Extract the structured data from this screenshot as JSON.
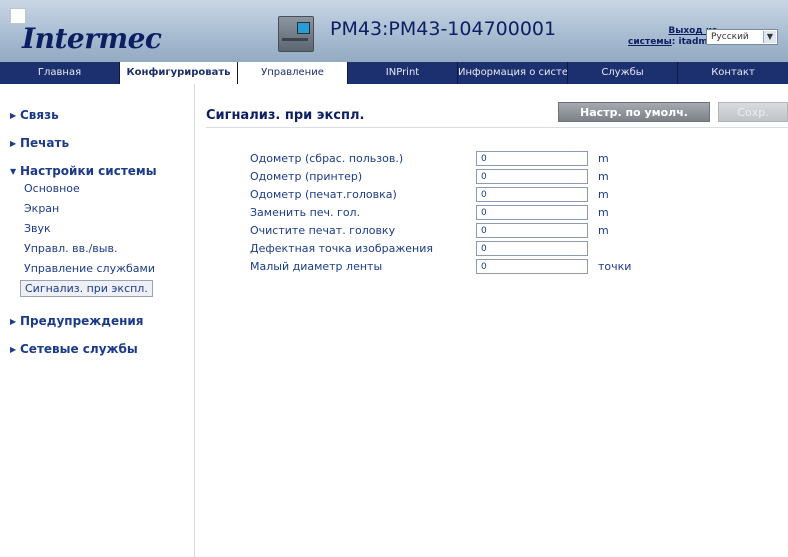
{
  "brand": {
    "logo_text": "Intermec"
  },
  "header": {
    "device_title": "PM43:PM43-104700001",
    "logout_line1": "Выход из",
    "logout_line2_link": "системы",
    "logout_line2_user": ": itadmin",
    "language": "Русский"
  },
  "nav": {
    "tabs": [
      {
        "label": "Главная"
      },
      {
        "label": "Конфигурировать"
      },
      {
        "label": "Управление"
      },
      {
        "label": "INPrint"
      },
      {
        "label": "Информация о системе"
      },
      {
        "label": "Службы"
      },
      {
        "label": "Контакт"
      }
    ]
  },
  "sidebar": {
    "sections": [
      {
        "label": "Связь"
      },
      {
        "label": "Печать"
      },
      {
        "label": "Настройки системы"
      },
      {
        "label": "Предупреждения"
      },
      {
        "label": "Сетевые службы"
      }
    ],
    "subitems": [
      {
        "label": "Основное"
      },
      {
        "label": "Экран"
      },
      {
        "label": "Звук"
      },
      {
        "label": "Управл. вв./выв."
      },
      {
        "label": "Управление службами"
      },
      {
        "label": "Сигнализ. при экспл."
      }
    ]
  },
  "main": {
    "title": "Сигнализ. при экспл.",
    "defaults_button": "Настр. по умолч.",
    "save_button": "Сохр.",
    "rows": [
      {
        "label": "Одометр (сбрас. пользов.)",
        "value": "0",
        "unit": "m"
      },
      {
        "label": "Одометр (принтер)",
        "value": "0",
        "unit": "m"
      },
      {
        "label": "Одометр (печат.головка)",
        "value": "0",
        "unit": "m"
      },
      {
        "label": "Заменить печ. гол.",
        "value": "0",
        "unit": "m"
      },
      {
        "label": "Очистите печат. головку",
        "value": "0",
        "unit": "m"
      },
      {
        "label": "Дефектная точка изображения",
        "value": "0",
        "unit": ""
      },
      {
        "label": "Малый диаметр ленты",
        "value": "0",
        "unit": "точки"
      }
    ]
  },
  "colors": {
    "nav_bg": "#1c2f6e",
    "text": "#1b3b8a",
    "header_bg": "#a9bdd2"
  }
}
